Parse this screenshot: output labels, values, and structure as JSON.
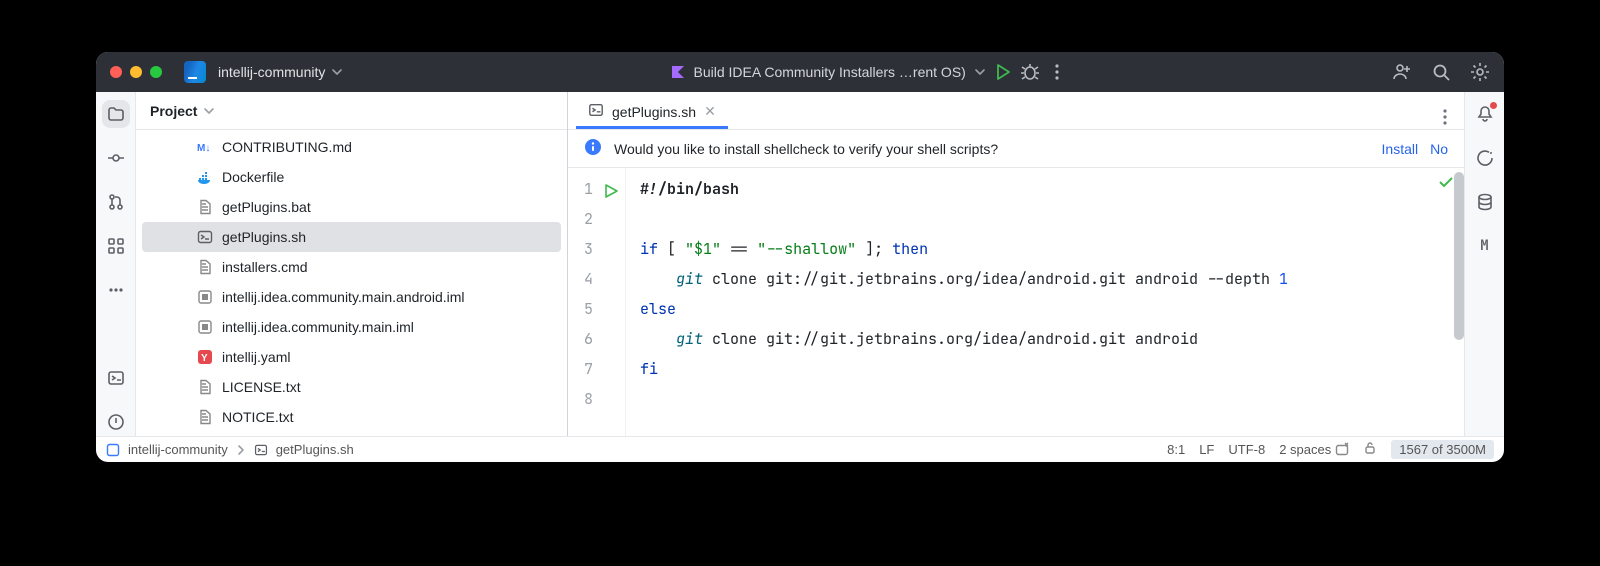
{
  "titlebar": {
    "project": "intellij-community",
    "run_config": "Build IDEA Community Installers …rent OS)"
  },
  "project_panel": {
    "title": "Project",
    "files": [
      {
        "name": "CONTRIBUTING.md",
        "icon": "md"
      },
      {
        "name": "Dockerfile",
        "icon": "docker"
      },
      {
        "name": "getPlugins.bat",
        "icon": "txt"
      },
      {
        "name": "getPlugins.sh",
        "icon": "sh",
        "selected": true
      },
      {
        "name": "installers.cmd",
        "icon": "txt"
      },
      {
        "name": "intellij.idea.community.main.android.iml",
        "icon": "iml"
      },
      {
        "name": "intellij.idea.community.main.iml",
        "icon": "iml"
      },
      {
        "name": "intellij.yaml",
        "icon": "yaml"
      },
      {
        "name": "LICENSE.txt",
        "icon": "txt"
      },
      {
        "name": "NOTICE.txt",
        "icon": "txt"
      }
    ]
  },
  "editor": {
    "tab_label": "getPlugins.sh",
    "notification": {
      "text": "Would you like to install shellcheck to verify your shell scripts?",
      "install": "Install",
      "no": "No"
    },
    "code": {
      "lines": [
        {
          "n": 1,
          "seg": [
            {
              "t": "#!/bin/bash",
              "c": "c-b"
            }
          ]
        },
        {
          "n": 2,
          "seg": [
            {
              "t": "",
              "c": ""
            }
          ]
        },
        {
          "n": 3,
          "seg": [
            {
              "t": "if",
              "c": "c-kw"
            },
            {
              "t": " [ ",
              "c": ""
            },
            {
              "t": "\"$1\"",
              "c": "c-str"
            },
            {
              "t": " == ",
              "c": ""
            },
            {
              "t": "\"--shallow\"",
              "c": "c-str"
            },
            {
              "t": " ]; ",
              "c": ""
            },
            {
              "t": "then",
              "c": "c-kw"
            }
          ]
        },
        {
          "n": 4,
          "seg": [
            {
              "t": "    ",
              "c": ""
            },
            {
              "t": "git",
              "c": "c-cmd"
            },
            {
              "t": " clone git://git.jetbrains.org/idea/android.git android --depth ",
              "c": ""
            },
            {
              "t": "1",
              "c": "c-num"
            }
          ]
        },
        {
          "n": 5,
          "seg": [
            {
              "t": "else",
              "c": "c-kw"
            }
          ]
        },
        {
          "n": 6,
          "seg": [
            {
              "t": "    ",
              "c": ""
            },
            {
              "t": "git",
              "c": "c-cmd"
            },
            {
              "t": " clone git://git.jetbrains.org/idea/android.git android",
              "c": ""
            }
          ]
        },
        {
          "n": 7,
          "seg": [
            {
              "t": "fi",
              "c": "c-kw"
            }
          ]
        },
        {
          "n": 8,
          "seg": [
            {
              "t": "",
              "c": ""
            }
          ]
        }
      ]
    }
  },
  "breadcrumb": {
    "root": "intellij-community",
    "file": "getPlugins.sh"
  },
  "status": {
    "pos": "8:1",
    "le": "LF",
    "enc": "UTF-8",
    "indent": "2 spaces",
    "mem": "1567 of 3500M"
  }
}
